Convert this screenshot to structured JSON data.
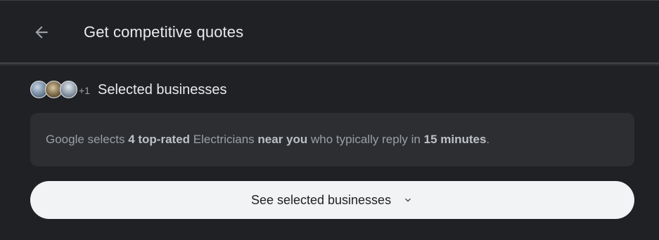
{
  "header": {
    "title": "Get competitive quotes",
    "back_icon": "arrow-back-icon"
  },
  "selected": {
    "extra_count": "+1",
    "label": "Selected businesses"
  },
  "info": {
    "t1": "Google selects ",
    "b1": "4 top-rated",
    "t2": " Electricians ",
    "b2": "near you",
    "t3": " who typically reply in ",
    "b3": "15 minutes",
    "t4": "."
  },
  "see_button": {
    "label": "See selected businesses",
    "icon": "chevron-down-icon"
  },
  "colors": {
    "background": "#202124",
    "card": "#2d2e31",
    "button": "#f1f3f4"
  }
}
